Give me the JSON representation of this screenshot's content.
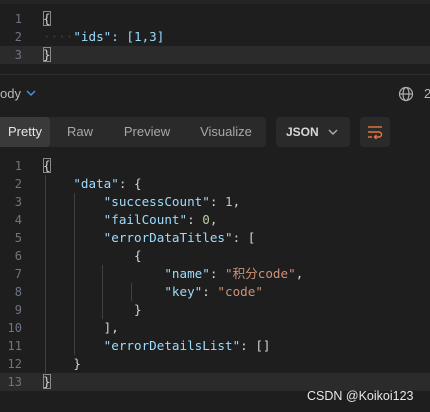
{
  "request_editor": {
    "lines": [
      {
        "num": "1",
        "text": "{"
      },
      {
        "num": "2",
        "text": "\"ids\": [1,3]"
      },
      {
        "num": "3",
        "text": "}"
      }
    ]
  },
  "response_header": {
    "label": "ody",
    "edge_text": "2"
  },
  "tabs": {
    "pretty": "Pretty",
    "raw": "Raw",
    "preview": "Preview",
    "visualize": "Visualize",
    "active": "Pretty"
  },
  "format_select": {
    "value": "JSON"
  },
  "icons": {
    "chevron": "chevron-down-icon",
    "globe": "globe-icon",
    "wrap": "wrap-lines-icon"
  },
  "response_editor": {
    "line_numbers": [
      "1",
      "2",
      "3",
      "4",
      "5",
      "6",
      "7",
      "8",
      "9",
      "10",
      "11",
      "12",
      "13"
    ],
    "tokens": {
      "l1_brace": "{",
      "l2_key": "\"data\"",
      "l2_rest": ": {",
      "l3_key": "\"successCount\"",
      "l3_colon": ": ",
      "l3_val": "1",
      "l3_comma": ",",
      "l4_key": "\"failCount\"",
      "l4_colon": ": ",
      "l4_val": "0",
      "l4_comma": ",",
      "l5_key": "\"errorDataTitles\"",
      "l5_rest": ": [",
      "l6_brace": "{",
      "l7_key": "\"name\"",
      "l7_colon": ": ",
      "l7_val": "\"积分code\"",
      "l7_comma": ",",
      "l8_key": "\"key\"",
      "l8_colon": ": ",
      "l8_val": "\"code\"",
      "l9_brace": "}",
      "l10_bracket": "],",
      "l11_key": "\"errorDetailsList\"",
      "l11_rest": ": []",
      "l12_brace": "}",
      "l13_brace": "}"
    }
  },
  "colors": {
    "background": "#1e1e1e",
    "key": "#9cdcfe",
    "string": "#ce9178",
    "number": "#b5cea8",
    "line_number": "#6e7681"
  },
  "watermark": "CSDN @Koikoi123"
}
